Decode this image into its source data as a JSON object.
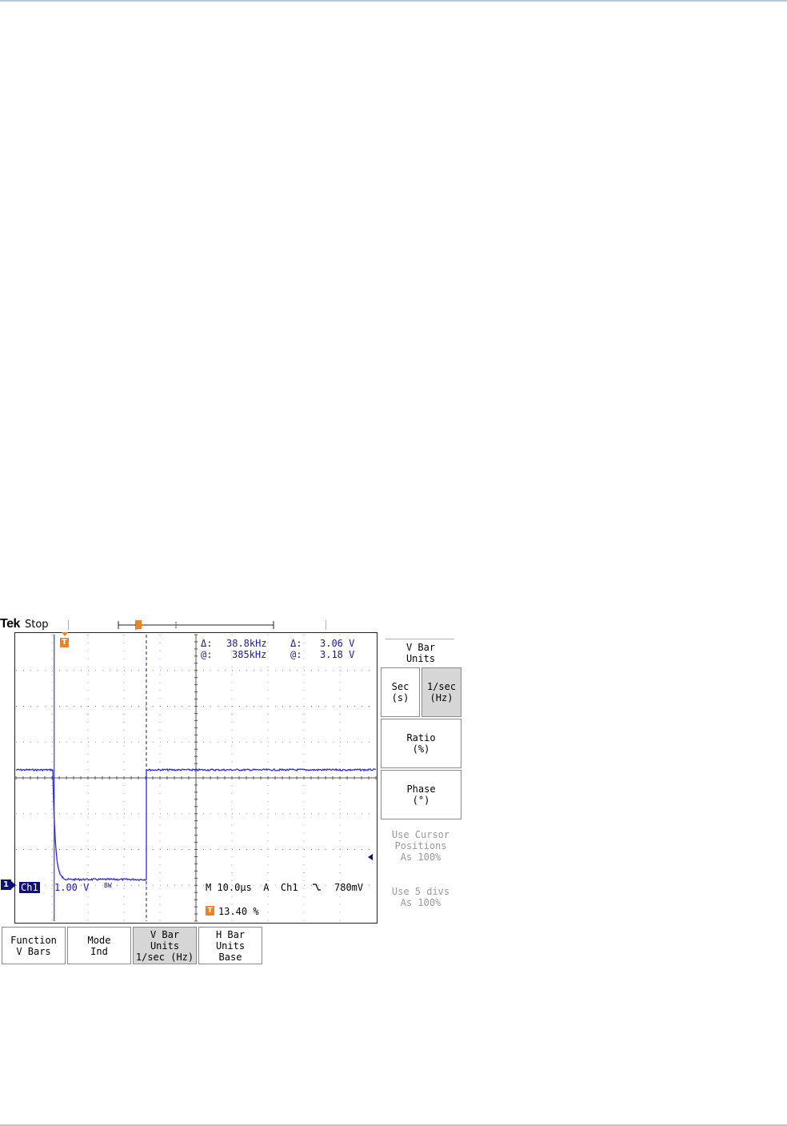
{
  "header": {
    "logo": "Tek",
    "status": "Stop"
  },
  "readouts": {
    "delta_h_symbol": "Δ:",
    "delta_h_value": "38.8kHz",
    "at_h_symbol": "@:",
    "at_h_value": "385kHz",
    "delta_v_symbol": "Δ:",
    "delta_v_value": "3.06 V",
    "at_v_symbol": "@:",
    "at_v_value": "3.18 V"
  },
  "channel": {
    "marker": "1",
    "label": "Ch1",
    "scale": "1.00 V",
    "bw_icon": "BW"
  },
  "timebase": {
    "text": "M 10.0µs  A  Ch1",
    "slope_icon": "falling-edge-icon",
    "trigger_level": "780mV"
  },
  "trigger_position": {
    "flag": "T",
    "value": "13.40 %"
  },
  "side_menu": {
    "title_line1": "V Bar",
    "title_line2": "Units",
    "sec_line1": "Sec",
    "sec_line2": "(s)",
    "hz_line1": "1/sec",
    "hz_line2": "(Hz)",
    "ratio_line1": "Ratio",
    "ratio_line2": "(%)",
    "phase_line1": "Phase",
    "phase_line2": "(°)",
    "use_cursor_line1": "Use Cursor",
    "use_cursor_line2": "Positions",
    "use_cursor_line3": "As 100%",
    "use_5div_line1": "Use 5 divs",
    "use_5div_line2": "As 100%"
  },
  "bottom_menu": [
    {
      "line1": "Function",
      "line2": "V Bars",
      "line3": ""
    },
    {
      "line1": "Mode",
      "line2": "Ind",
      "line3": ""
    },
    {
      "line1": "V Bar",
      "line2": "Units",
      "line3": "1/sec (Hz)"
    },
    {
      "line1": "H Bar",
      "line2": "Units",
      "line3": "Base"
    }
  ],
  "colors": {
    "trace": "#2a2ae0",
    "cursor": "#1a1aa0",
    "trigger": "#f08020",
    "selected_button": "#d6d6d6"
  },
  "waveform": {
    "time_per_div_us": 10.0,
    "volts_per_div": 1.0,
    "high_level_v": 0.0,
    "low_level_v": -3.06,
    "fall_time_us": 0.6,
    "low_start_us": 1.2,
    "rise_time_us": 26.0,
    "cursor1_time_us": 0.4,
    "cursor2_time_us": 26.0
  }
}
